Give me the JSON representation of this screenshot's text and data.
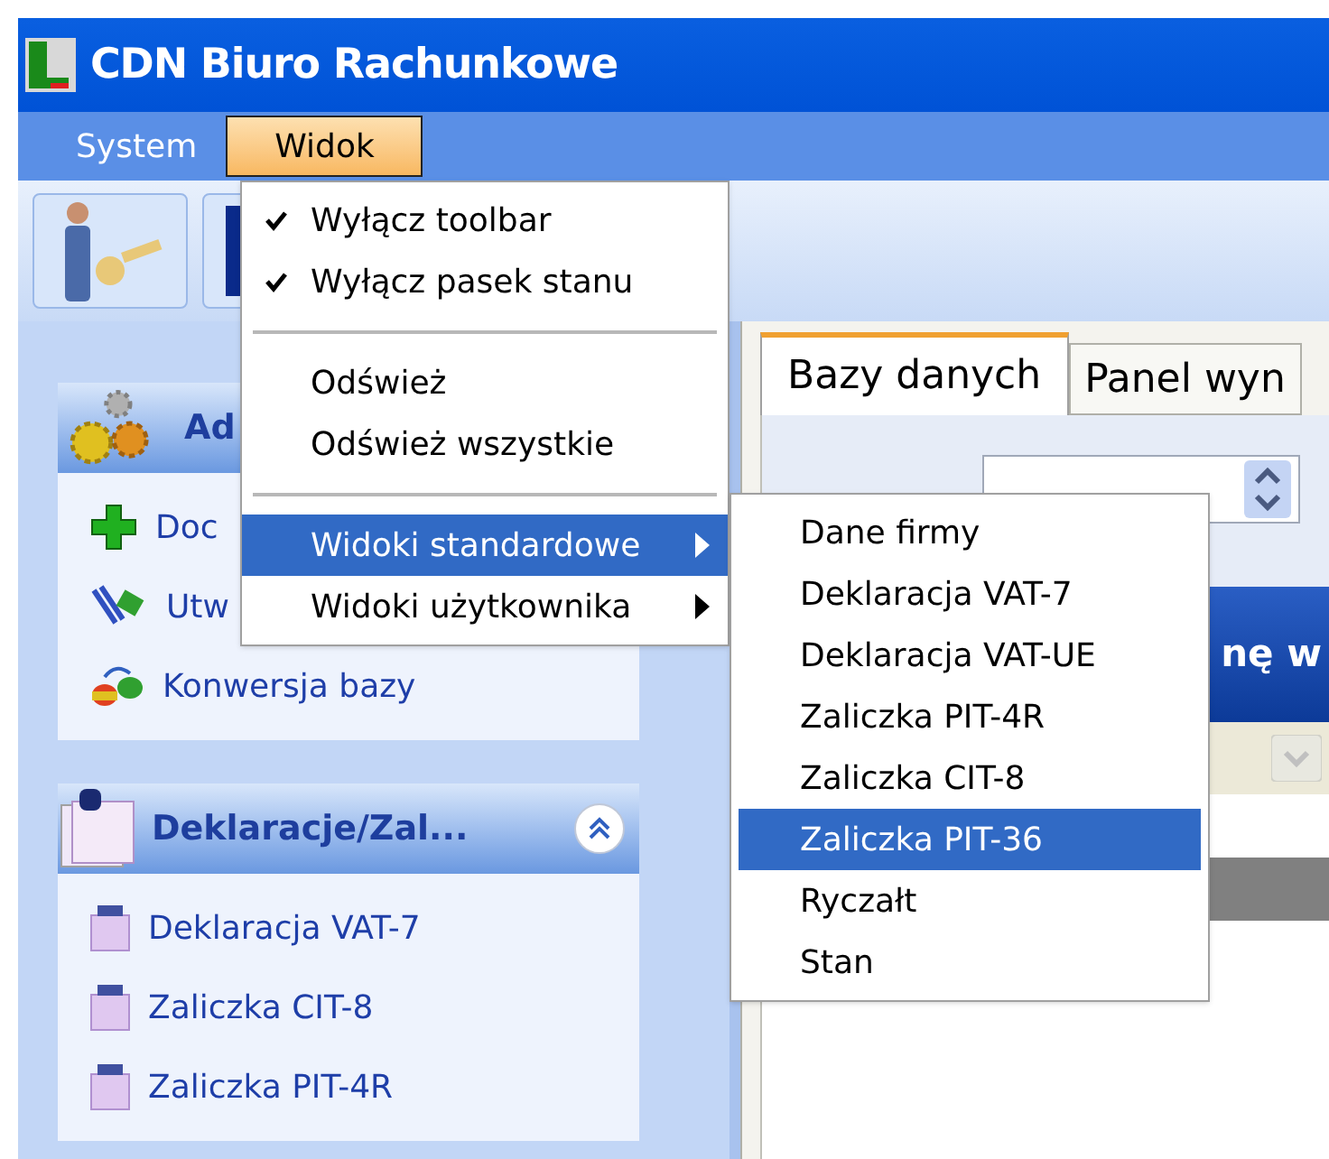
{
  "window": {
    "title": "CDN Biuro Rachunkowe"
  },
  "menu_bar": [
    {
      "label": "System",
      "selected": false
    },
    {
      "label": "Widok",
      "selected": true
    }
  ],
  "menu": {
    "items": [
      {
        "kind": "check",
        "label": "Wyłącz toolbar",
        "checked": true
      },
      {
        "kind": "check",
        "label": "Wyłącz pasek stanu",
        "checked": true
      },
      {
        "kind": "separator"
      },
      {
        "kind": "item",
        "label": "Odśwież"
      },
      {
        "kind": "item",
        "label": "Odśwież wszystkie"
      },
      {
        "kind": "separator"
      },
      {
        "kind": "submenu",
        "label": "Widoki standardowe",
        "selected": true
      },
      {
        "kind": "submenu",
        "label": "Widoki użytkownika",
        "selected": false
      }
    ]
  },
  "submenu": {
    "items": [
      {
        "label": "Dane firmy",
        "selected": false
      },
      {
        "label": "Deklaracja VAT-7",
        "selected": false
      },
      {
        "label": "Deklaracja VAT-UE",
        "selected": false
      },
      {
        "label": "Zaliczka PIT-4R",
        "selected": false
      },
      {
        "label": "Zaliczka CIT-8",
        "selected": false
      },
      {
        "label": "Zaliczka PIT-36",
        "selected": true
      },
      {
        "label": "Ryczałt",
        "selected": false
      },
      {
        "label": "Stan",
        "selected": false
      }
    ]
  },
  "sidebar": {
    "groups": [
      {
        "title": "Ad",
        "items": [
          {
            "label": "Doc"
          },
          {
            "label": "Utw"
          },
          {
            "label": "Konwersja bazy"
          }
        ]
      },
      {
        "title": "Deklaracje/Zal...",
        "items": [
          {
            "label": "Deklaracja VAT-7"
          },
          {
            "label": "Zaliczka CIT-8"
          },
          {
            "label": "Zaliczka PIT-4R"
          }
        ]
      }
    ]
  },
  "tabs": [
    {
      "label": "Bazy danych",
      "selected": true
    },
    {
      "label": "Panel wyn",
      "selected": false
    }
  ],
  "banner": {
    "text": "nę w"
  }
}
